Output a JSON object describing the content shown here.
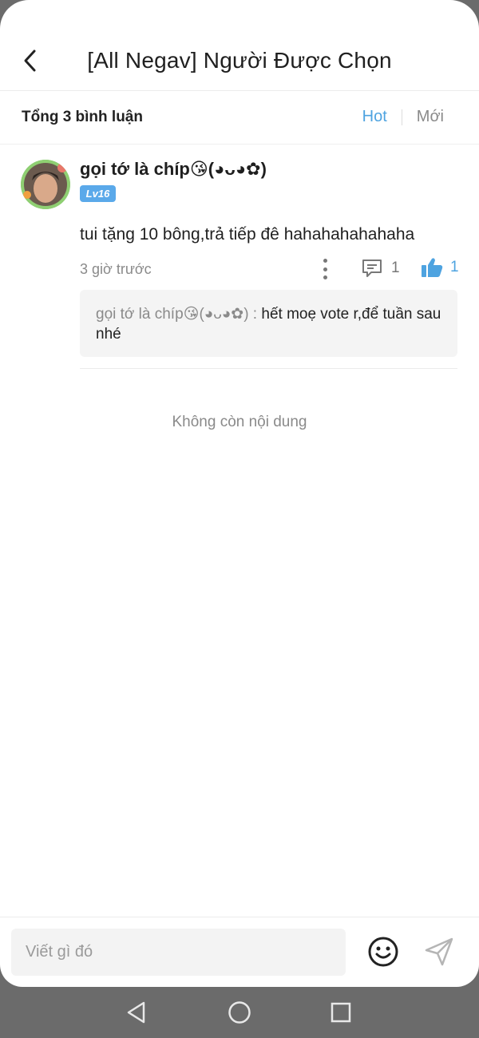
{
  "header": {
    "title": "[All Negav] Người Được Chọn"
  },
  "subbar": {
    "total": "Tổng 3 bình luận",
    "sort_hot": "Hot",
    "sort_new": "Mới"
  },
  "comment": {
    "username": "gọi tớ là chíp😘(◕ᴗ◕✿)",
    "level": "Lv16",
    "text": "tui tặng 10 bông,trả tiếp đê hahahahahahaha",
    "time": "3 giờ trước",
    "reply_count": "1",
    "like_count": "1",
    "reply": {
      "name": "gọi tớ là chíp😘(◕ᴗ◕✿) :",
      "text": "hết moẹ vote r,để tuần sau nhé"
    }
  },
  "no_more": "Không còn nội dung",
  "composer": {
    "placeholder": "Viết gì đó"
  },
  "colors": {
    "accent": "#4ea3e0",
    "level_badge": "#5aa9ea"
  },
  "icons": [
    "back-arrow-icon",
    "more-icon",
    "comment-icon",
    "thumbs-up-icon",
    "emoji-icon",
    "send-icon",
    "nav-back-icon",
    "nav-home-icon",
    "nav-recents-icon"
  ]
}
